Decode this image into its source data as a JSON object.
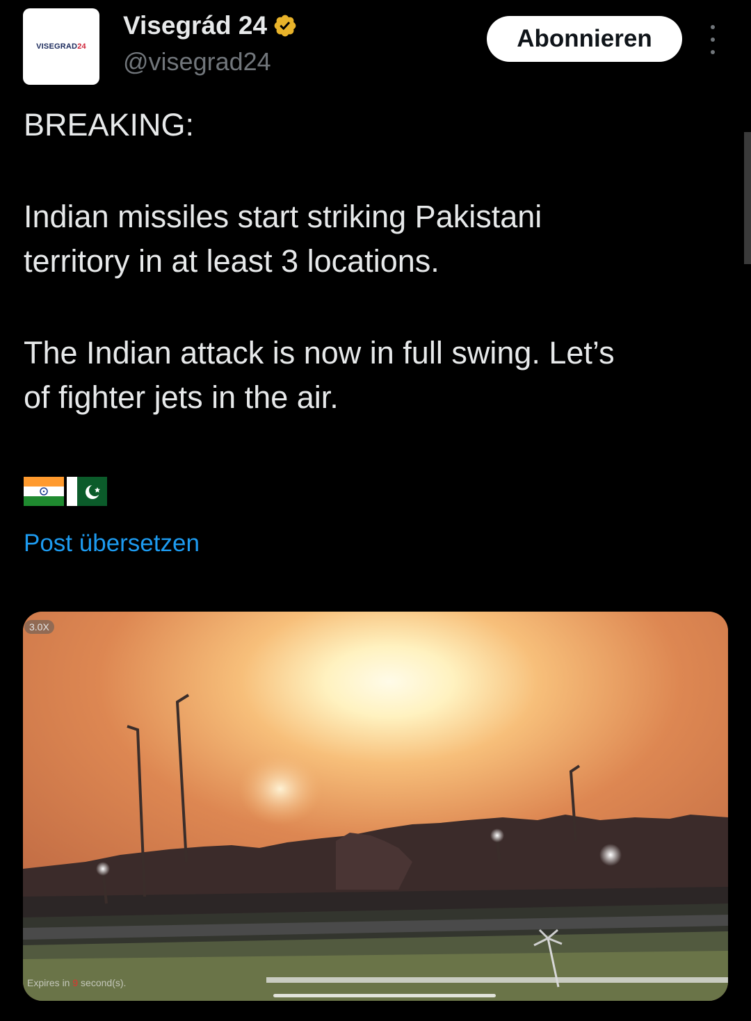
{
  "author": {
    "avatar_label": "VISEGRAD",
    "avatar_label_accent": "24",
    "display_name": "Visegrád 24",
    "handle": "@visegrad24",
    "verified_icon": "verified-badge-gold",
    "verified_color": "#e8b32a"
  },
  "actions": {
    "subscribe_label": "Abonnieren",
    "more_icon": "more-vertical-icon"
  },
  "tweet": {
    "line1": "BREAKING:",
    "line2": "Indian missiles start striking Pakistani",
    "line3": "territory in at least 3 locations.",
    "line4": "The Indian attack is now in full swing. Let’s",
    "line5": "of fighter jets in the air.",
    "flags": [
      "India flag",
      "Pakistan flag"
    ]
  },
  "translate_label": "Post übersetzen",
  "media": {
    "zoom_label": "3.0X",
    "expires_prefix": "Expires in ",
    "expires_number": "9",
    "expires_suffix": " second(s)."
  },
  "colors": {
    "background": "#000000",
    "text": "#e7e9ea",
    "muted": "#71767b",
    "link": "#1d9bf0",
    "button_bg": "#ffffff"
  }
}
